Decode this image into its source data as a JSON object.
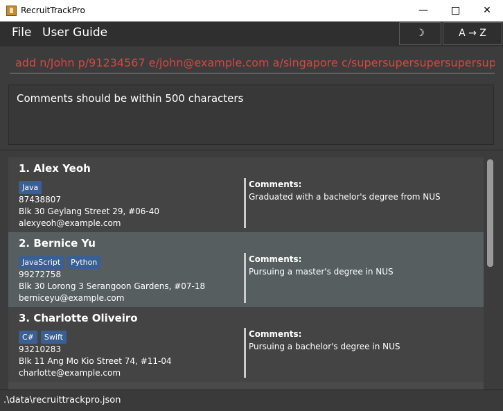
{
  "window": {
    "title": "RecruitTrackPro",
    "min_glyph": "—",
    "close_glyph": "✕"
  },
  "menu": {
    "file": "File",
    "user_guide": "User Guide"
  },
  "toolbar": {
    "theme_label": "☽",
    "sort_label": "A → Z"
  },
  "command": {
    "value": "add n/John p/91234567 e/john@example.com a/singapore c/supersupersupersupersupersupe"
  },
  "result": {
    "message": "Comments should be within 500 characters"
  },
  "persons": [
    {
      "index": "1.",
      "name": "Alex Yeoh",
      "tags": [
        "Java"
      ],
      "phone": "87438807",
      "address": "Blk 30 Geylang Street 29, #06-40",
      "email": "alexyeoh@example.com",
      "comments_label": "Comments:",
      "comments": "Graduated with a bachelor's degree from NUS"
    },
    {
      "index": "2.",
      "name": "Bernice Yu",
      "tags": [
        "JavaScript",
        "Python"
      ],
      "phone": "99272758",
      "address": "Blk 30 Lorong 3 Serangoon Gardens, #07-18",
      "email": "berniceyu@example.com",
      "comments_label": "Comments:",
      "comments": "Pursuing a master's degree in NUS"
    },
    {
      "index": "3.",
      "name": "Charlotte Oliveiro",
      "tags": [
        "C#",
        "Swift"
      ],
      "phone": "93210283",
      "address": "Blk 11 Ang Mo Kio Street 74, #11-04",
      "email": "charlotte@example.com",
      "comments_label": "Comments:",
      "comments": "Pursuing a bachelor's degree in NUS"
    }
  ],
  "selected_index": 1,
  "status": {
    "file_path": ".\\data\\recruittrackpro.json"
  },
  "colors": {
    "tag": "#3a5f93",
    "selected_card": "#575e60",
    "command_text": "#d84545"
  }
}
